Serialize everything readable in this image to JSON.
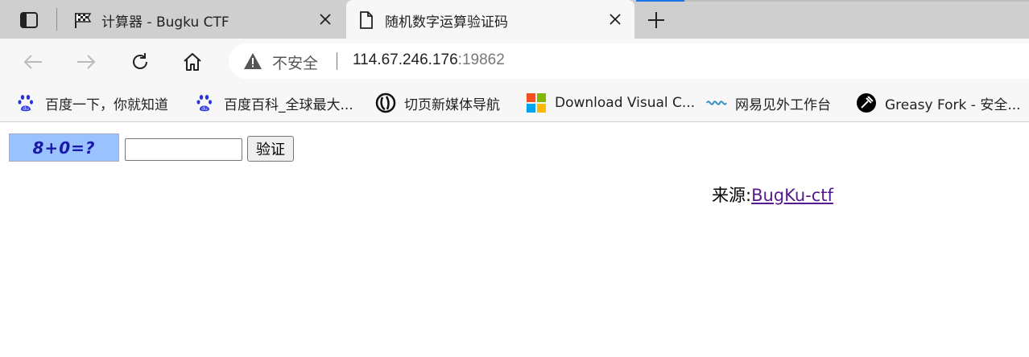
{
  "browser": {
    "tabs": [
      {
        "title": "计算器 - Bugku CTF",
        "active": false,
        "icon": "checkered-flag-icon"
      },
      {
        "title": "随机数字运算验证码",
        "active": true,
        "icon": "page-icon"
      }
    ],
    "address": {
      "security_label": "不安全",
      "url_host": "114.67.246.176",
      "url_port": ":19862"
    },
    "bookmarks": [
      {
        "label": "百度一下，你就知道",
        "icon": "baidu-paw-icon"
      },
      {
        "label": "百度百科_全球最大...",
        "icon": "baidu-paw-icon"
      },
      {
        "label": "切页新媒体导航",
        "icon": "qieye-logo-icon"
      },
      {
        "label": "Download Visual C...",
        "icon": "microsoft-logo-icon"
      },
      {
        "label": "网易见外工作台",
        "icon": "wave-logo-icon"
      },
      {
        "label": "Greasy Fork - 安全...",
        "icon": "greasyfork-logo-icon"
      }
    ],
    "colors": {
      "accent": "#1a73e8",
      "tabstrip": "#cfcfcf",
      "toolbar": "#f7f7f7"
    }
  },
  "page": {
    "captcha_text": "8+0=?",
    "captcha_bg": "#99c2ff",
    "answer_value": "",
    "verify_label": "验证",
    "source_prefix": "来源:",
    "source_link": "BugKu-ctf"
  }
}
